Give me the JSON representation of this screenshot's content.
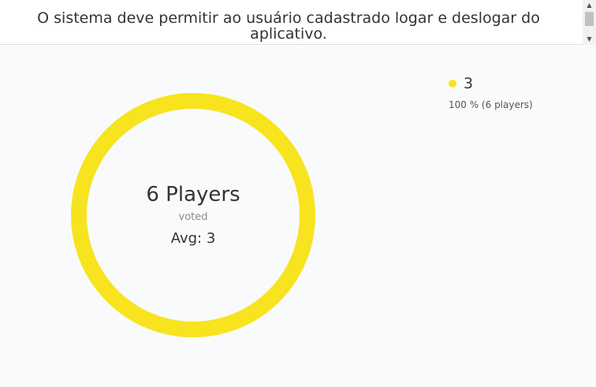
{
  "story": {
    "title": "O sistema deve permitir ao usuário cadastrado logar e deslogar do aplicativo."
  },
  "scrollbar": {
    "up_icon": "chevron-up-icon",
    "down_icon": "chevron-down-icon"
  },
  "results": {
    "players_label": "6 Players",
    "voted_label": "voted",
    "average_label": "Avg: 3",
    "accent_color": "#f7e41f",
    "legend": [
      {
        "value": "3",
        "detail": "100 % (6 players)",
        "color": "#f7e41f",
        "share": 1.0
      }
    ]
  },
  "chart_data": {
    "type": "pie",
    "categories": [
      "3"
    ],
    "values": [
      6
    ],
    "title": "",
    "xlabel": "",
    "ylabel": ""
  }
}
